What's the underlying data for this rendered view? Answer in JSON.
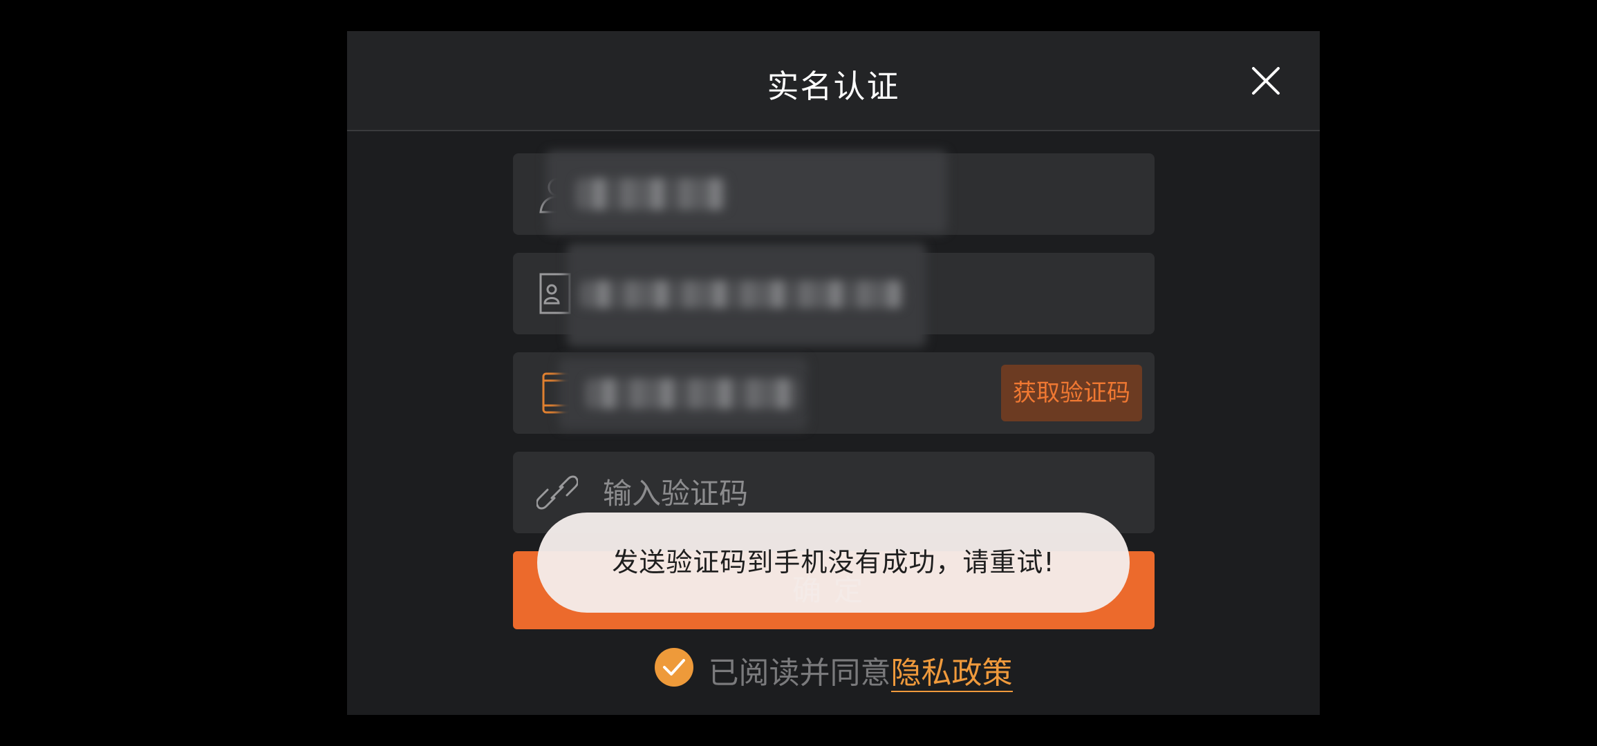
{
  "dialog": {
    "title": "实名认证",
    "close_icon": "close-icon"
  },
  "form": {
    "name_field": {
      "icon": "user-icon",
      "value": ""
    },
    "id_field": {
      "icon": "id-card-icon",
      "value_suffix": "5"
    },
    "phone_field": {
      "icon": "phone-icon",
      "value": "",
      "get_code_label": "获取验证码"
    },
    "code_field": {
      "icon": "link-icon",
      "placeholder": "输入验证码"
    },
    "confirm_label": "确定"
  },
  "agreement": {
    "checked": true,
    "text": "已阅读并同意",
    "link_text": "隐私政策"
  },
  "toast": {
    "message": "发送验证码到手机没有成功，请重试!"
  },
  "colors": {
    "accent": "#ec6a2c",
    "link": "#f09a3c",
    "background": "#1c1d1f"
  }
}
